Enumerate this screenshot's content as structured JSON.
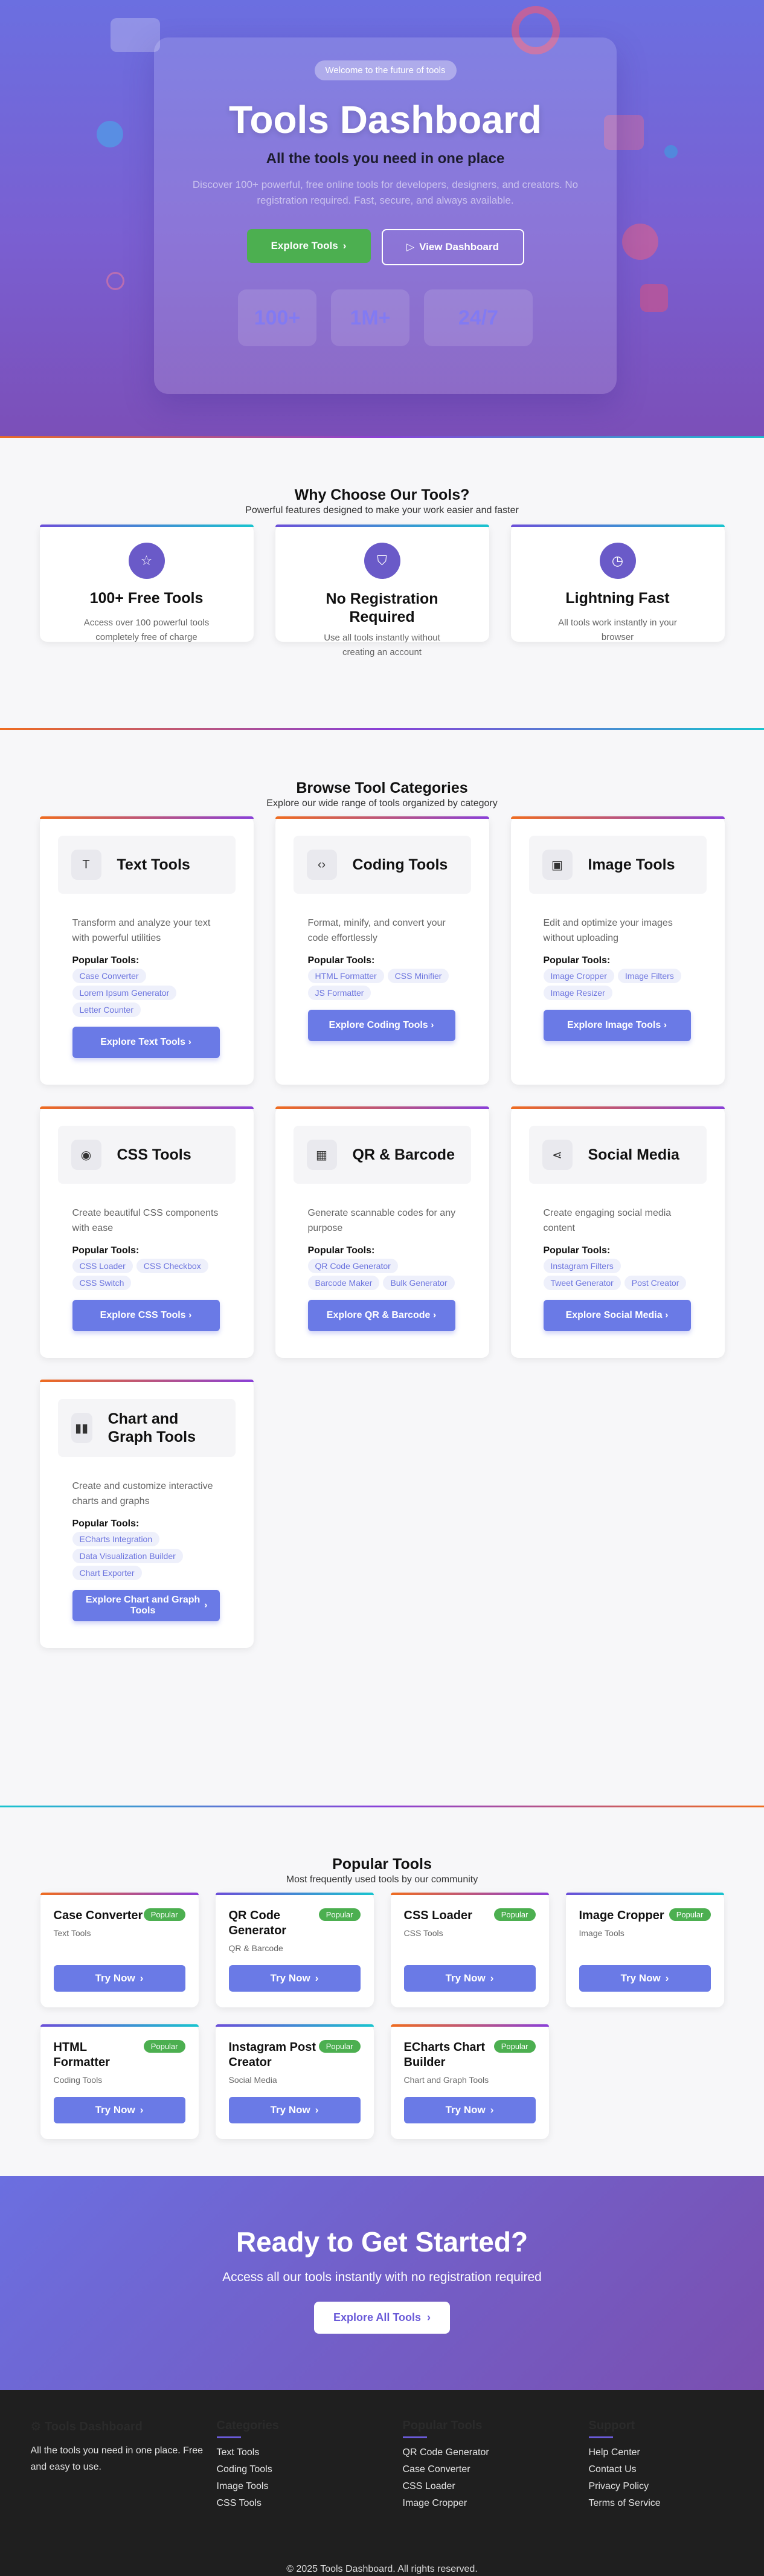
{
  "hero": {
    "pill": "Welcome to the future of tools",
    "title": "Tools Dashboard",
    "subtitle": "All the tools you need in one place",
    "description": "Discover 100+ powerful, free online tools for developers, designers, and creators. No registration required. Fast, secure, and always available.",
    "primary_btn": "Explore Tools",
    "secondary_btn": "View Dashboard",
    "stats": [
      "100+",
      "1M+",
      "24/7"
    ]
  },
  "why": {
    "title": "Why Choose Our Tools?",
    "subtitle": "Powerful features designed to make your work easier and faster",
    "cards": [
      {
        "icon": "star-icon",
        "title": "100+ Free Tools",
        "desc": "Access over 100 powerful tools completely free of charge"
      },
      {
        "icon": "shield-icon",
        "title": "No Registration Required",
        "desc": "Use all tools instantly without creating an account"
      },
      {
        "icon": "clock-icon",
        "title": "Lightning Fast",
        "desc": "All tools work instantly in your browser"
      }
    ]
  },
  "categories": {
    "title": "Browse Tool Categories",
    "subtitle": "Explore our wide range of tools organized by category",
    "popular_label": "Popular Tools:",
    "items": [
      {
        "icon": "text-icon",
        "name": "Text Tools",
        "desc": "Transform and analyze your text with powerful utilities",
        "tags": [
          "Case Converter",
          "Lorem Ipsum Generator",
          "Letter Counter"
        ],
        "btn": "Explore Text Tools"
      },
      {
        "icon": "code-icon",
        "name": "Coding Tools",
        "desc": "Format, minify, and convert your code effortlessly",
        "tags": [
          "HTML Formatter",
          "CSS Minifier",
          "JS Formatter"
        ],
        "btn": "Explore Coding Tools"
      },
      {
        "icon": "image-icon",
        "name": "Image Tools",
        "desc": "Edit and optimize your images without uploading",
        "tags": [
          "Image Cropper",
          "Image Filters",
          "Image Resizer"
        ],
        "btn": "Explore Image Tools"
      },
      {
        "icon": "palette-icon",
        "name": "CSS Tools",
        "desc": "Create beautiful CSS components with ease",
        "tags": [
          "CSS Loader",
          "CSS Checkbox",
          "CSS Switch"
        ],
        "btn": "Explore CSS Tools"
      },
      {
        "icon": "qrcode-icon",
        "name": "QR & Barcode",
        "desc": "Generate scannable codes for any purpose",
        "tags": [
          "QR Code Generator",
          "Barcode Maker",
          "Bulk Generator"
        ],
        "btn": "Explore QR & Barcode"
      },
      {
        "icon": "share-icon",
        "name": "Social Media",
        "desc": "Create engaging social media content",
        "tags": [
          "Instagram Filters",
          "Tweet Generator",
          "Post Creator"
        ],
        "btn": "Explore Social Media"
      },
      {
        "icon": "chart-icon",
        "name": "Chart and Graph Tools",
        "desc": "Create and customize interactive charts and graphs",
        "tags": [
          "ECharts Integration",
          "Data Visualization Builder",
          "Chart Exporter"
        ],
        "btn": "Explore Chart and Graph Tools"
      }
    ]
  },
  "popular": {
    "title": "Popular Tools",
    "subtitle": "Most frequently used tools by our community",
    "badge": "Popular",
    "btn": "Try Now",
    "items": [
      {
        "name": "Case Converter",
        "cat": "Text Tools"
      },
      {
        "name": "QR Code Generator",
        "cat": "QR & Barcode"
      },
      {
        "name": "CSS Loader",
        "cat": "CSS Tools"
      },
      {
        "name": "Image Cropper",
        "cat": "Image Tools"
      },
      {
        "name": "HTML Formatter",
        "cat": "Coding Tools"
      },
      {
        "name": "Instagram Post Creator",
        "cat": "Social Media"
      },
      {
        "name": "ECharts Chart Builder",
        "cat": "Chart and Graph Tools"
      }
    ]
  },
  "cta": {
    "title": "Ready to Get Started?",
    "subtitle": "Access all our tools instantly with no registration required",
    "btn": "Explore All Tools"
  },
  "footer": {
    "brand": "Tools Dashboard",
    "brand_text": "All the tools you need in one place. Free and easy to use.",
    "columns": [
      {
        "title": "Categories",
        "links": [
          "Text Tools",
          "Coding Tools",
          "Image Tools",
          "CSS Tools"
        ]
      },
      {
        "title": "Popular Tools",
        "links": [
          "QR Code Generator",
          "Case Converter",
          "CSS Loader",
          "Image Cropper"
        ]
      },
      {
        "title": "Support",
        "links": [
          "Help Center",
          "Contact Us",
          "Privacy Policy",
          "Terms of Service"
        ]
      }
    ],
    "copyright": "© 2025 Tools Dashboard. All rights reserved."
  },
  "colors": {
    "primary": "#6a7ae6",
    "green": "#4caf50",
    "hero_from": "#6b6fe0",
    "hero_to": "#7b4fb8"
  }
}
